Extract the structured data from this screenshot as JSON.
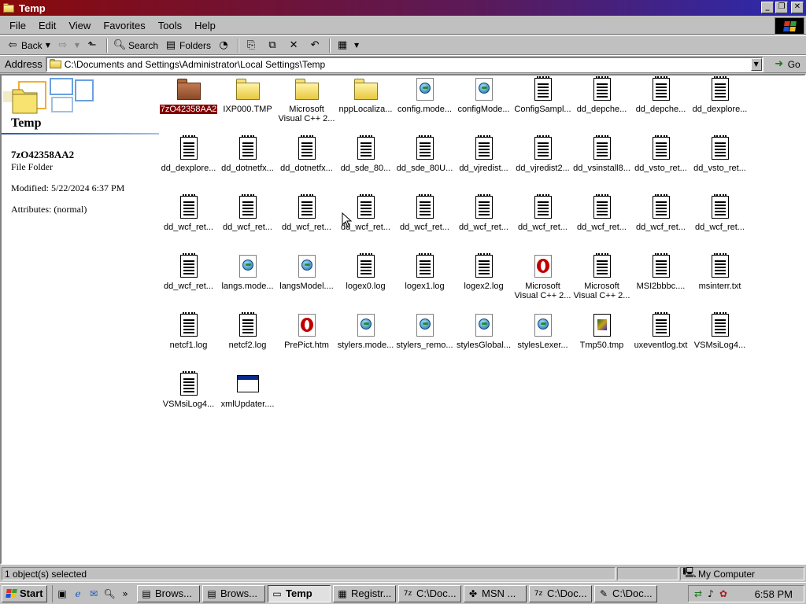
{
  "window": {
    "title": "Temp",
    "controls": {
      "minimize": "_",
      "restore": "❐",
      "close": "✕"
    }
  },
  "menu": [
    "File",
    "Edit",
    "View",
    "Favorites",
    "Tools",
    "Help"
  ],
  "toolbar": {
    "back_label": "Back",
    "search_label": "Search",
    "folders_label": "Folders",
    "icons": [
      "back-arrow-icon",
      "forward-arrow-icon",
      "up-folder-icon",
      "search-icon",
      "folders-icon",
      "history-icon",
      "move-to-icon",
      "copy-to-icon",
      "delete-icon",
      "undo-icon",
      "views-icon"
    ]
  },
  "address": {
    "label": "Address",
    "path": "C:\\Documents and Settings\\Administrator\\Local Settings\\Temp",
    "go_label": "Go"
  },
  "side_panel": {
    "title": "Temp",
    "selected_name": "7zO42358AA2",
    "selected_type": "File Folder",
    "modified": "Modified: 5/22/2024 6:37 PM",
    "attributes": "Attributes: (normal)"
  },
  "files": [
    {
      "label": "7zO42358AA2",
      "type": "folder-brown",
      "selected": true
    },
    {
      "label": "IXP000.TMP",
      "type": "folder"
    },
    {
      "label": "Microsoft Visual C++ 2...",
      "type": "folder"
    },
    {
      "label": "nppLocaliza...",
      "type": "folder"
    },
    {
      "label": "config.mode...",
      "type": "web"
    },
    {
      "label": "configMode...",
      "type": "web"
    },
    {
      "label": "ConfigSampl...",
      "type": "doc"
    },
    {
      "label": "dd_depche...",
      "type": "doc"
    },
    {
      "label": "dd_depche...",
      "type": "doc"
    },
    {
      "label": "dd_dexplore...",
      "type": "doc"
    },
    {
      "label": "dd_dexplore...",
      "type": "doc"
    },
    {
      "label": "dd_dotnetfx...",
      "type": "doc"
    },
    {
      "label": "dd_dotnetfx...",
      "type": "doc"
    },
    {
      "label": "dd_sde_80...",
      "type": "doc"
    },
    {
      "label": "dd_sde_80U...",
      "type": "doc"
    },
    {
      "label": "dd_vjredist...",
      "type": "doc"
    },
    {
      "label": "dd_vjredist2...",
      "type": "doc"
    },
    {
      "label": "dd_vsinstall8...",
      "type": "doc"
    },
    {
      "label": "dd_vsto_ret...",
      "type": "doc"
    },
    {
      "label": "dd_vsto_ret...",
      "type": "doc"
    },
    {
      "label": "dd_wcf_ret...",
      "type": "doc"
    },
    {
      "label": "dd_wcf_ret...",
      "type": "doc"
    },
    {
      "label": "dd_wcf_ret...",
      "type": "doc"
    },
    {
      "label": "dd_wcf_ret...",
      "type": "doc"
    },
    {
      "label": "dd_wcf_ret...",
      "type": "doc"
    },
    {
      "label": "dd_wcf_ret...",
      "type": "doc"
    },
    {
      "label": "dd_wcf_ret...",
      "type": "doc"
    },
    {
      "label": "dd_wcf_ret...",
      "type": "doc"
    },
    {
      "label": "dd_wcf_ret...",
      "type": "doc"
    },
    {
      "label": "dd_wcf_ret...",
      "type": "doc"
    },
    {
      "label": "dd_wcf_ret...",
      "type": "doc"
    },
    {
      "label": "langs.mode...",
      "type": "web"
    },
    {
      "label": "langsModel....",
      "type": "web"
    },
    {
      "label": "logex0.log",
      "type": "doc"
    },
    {
      "label": "logex1.log",
      "type": "doc"
    },
    {
      "label": "logex2.log",
      "type": "doc"
    },
    {
      "label": "Microsoft Visual C++ 2...",
      "type": "opera"
    },
    {
      "label": "Microsoft Visual C++ 2...",
      "type": "doc"
    },
    {
      "label": "MSI2bbbc....",
      "type": "doc"
    },
    {
      "label": "msinterr.txt",
      "type": "doc"
    },
    {
      "label": "netcf1.log",
      "type": "doc"
    },
    {
      "label": "netcf2.log",
      "type": "doc"
    },
    {
      "label": "PrePict.htm",
      "type": "opera"
    },
    {
      "label": "stylers.mode...",
      "type": "web"
    },
    {
      "label": "stylers_remo...",
      "type": "web"
    },
    {
      "label": "stylesGlobal...",
      "type": "web"
    },
    {
      "label": "stylesLexer...",
      "type": "web"
    },
    {
      "label": "Tmp50.tmp",
      "type": "video"
    },
    {
      "label": "uxeventlog.txt",
      "type": "doc"
    },
    {
      "label": "VSMsiLog4...",
      "type": "doc"
    },
    {
      "label": "VSMsiLog4...",
      "type": "doc"
    },
    {
      "label": "xmlUpdater....",
      "type": "window"
    }
  ],
  "status": {
    "text": "1 object(s) selected",
    "zone": "My Computer"
  },
  "taskbar": {
    "start": "Start",
    "quick_launch": [
      "show-desktop-icon",
      "ie-icon",
      "outlook-icon",
      "search-icon"
    ],
    "more": "»",
    "tasks": [
      {
        "label": "Brows...",
        "icon": "explorer-icon",
        "active": false
      },
      {
        "label": "Brows...",
        "icon": "explorer-icon",
        "active": false
      },
      {
        "label": "Temp",
        "icon": "folder-icon",
        "active": true
      },
      {
        "label": "Registr...",
        "icon": "regedit-icon",
        "active": false
      },
      {
        "label": "C:\\Doc...",
        "icon": "7zip-icon",
        "active": false
      },
      {
        "label": "MSN ...",
        "icon": "msn-icon",
        "active": false
      },
      {
        "label": "C:\\Doc...",
        "icon": "7zip-icon",
        "active": false
      },
      {
        "label": "C:\\Doc...",
        "icon": "notepad-icon",
        "active": false
      }
    ],
    "clock": "6:58 PM"
  },
  "colors": {
    "selection": "#800000",
    "title_start": "#8a0a0a",
    "title_end": "#2a2ab0"
  }
}
